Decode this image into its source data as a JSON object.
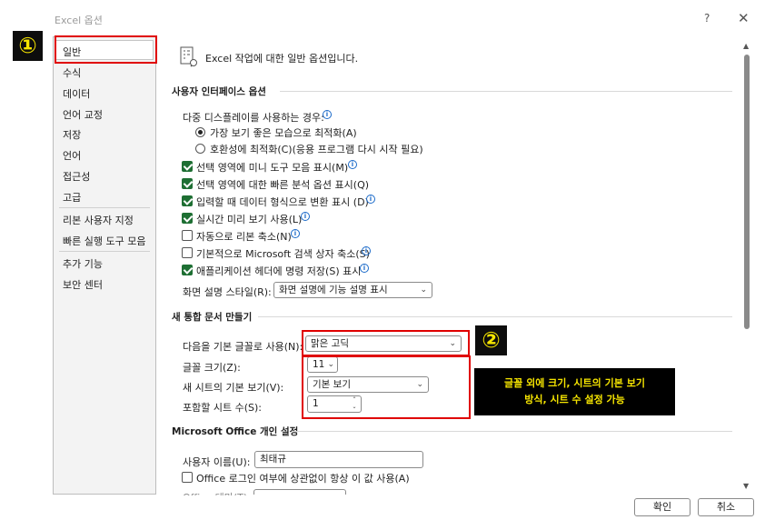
{
  "window": {
    "title": "Excel 옵션",
    "help": "?",
    "close": "✕"
  },
  "badges": {
    "one": "①",
    "two": "②"
  },
  "sidebar": {
    "items": [
      {
        "label": "일반"
      },
      {
        "label": "수식"
      },
      {
        "label": "데이터"
      },
      {
        "label": "언어 교정"
      },
      {
        "label": "저장"
      },
      {
        "label": "언어"
      },
      {
        "label": "접근성"
      },
      {
        "label": "고급"
      },
      {
        "label": "리본 사용자 지정"
      },
      {
        "label": "빠른 실행 도구 모음"
      },
      {
        "label": "추가 기능"
      },
      {
        "label": "보안 센터"
      }
    ]
  },
  "main": {
    "header": "Excel 작업에 대한 일반 옵션입니다.",
    "ui_section": {
      "title": "사용자 인터페이스 옵션",
      "multi_display_label": "다중 디스플레이를 사용하는 경우:",
      "radio_best": "가장 보기 좋은 모습으로 최적화(A)",
      "radio_compat": "호환성에 최적화(C)(응용 프로그램 다시 시작 필요)",
      "options": [
        {
          "label": "선택 영역에 미니 도구 모음 표시(M)",
          "checked": true
        },
        {
          "label": "선택 영역에 대한 빠른 분석 옵션 표시(Q)",
          "checked": true
        },
        {
          "label": "입력할 때 데이터 형식으로 변환 표시 (D)",
          "checked": true
        },
        {
          "label": "실시간 미리 보기 사용(L)",
          "checked": true
        },
        {
          "label": "자동으로 리본 축소(N)",
          "checked": false
        },
        {
          "label": "기본적으로 Microsoft 검색 상자 축소(S)",
          "checked": false
        },
        {
          "label": "애플리케이션 헤더에 명령 저장(S) 표시",
          "checked": true
        }
      ],
      "tooltip_label": "화면 설명 스타일(R):",
      "tooltip_value": "화면 설명에 기능 설명 표시"
    },
    "new_wb_section": {
      "title": "새 통합 문서 만들기",
      "font_label": "다음을 기본 글꼴로 사용(N):",
      "font_value": "맑은 고딕",
      "size_label": "글꼴 크기(Z):",
      "size_value": "11",
      "view_label": "새 시트의 기본 보기(V):",
      "view_value": "기본 보기",
      "sheets_label": "포함할 시트 수(S):",
      "sheets_value": "1"
    },
    "personal_section": {
      "title": "Microsoft Office 개인 설정",
      "username_label": "사용자 이름(U):",
      "username_value": "최태규",
      "always_use_label": "Office 로그인 여부에 상관없이 항상 이 값 사용(A)",
      "theme_label": "Office 테마(T):"
    }
  },
  "callout": {
    "line1": "글꼴 외에 크기, 시트의 기본 보기",
    "line2": "방식, 시트 수 설정 가능"
  },
  "buttons": {
    "ok": "확인",
    "cancel": "취소"
  },
  "colors": {
    "highlight_border": "#e00000",
    "badge_bg": "#0d0d0d",
    "badge_fg": "#f5e400",
    "checkbox_on": "#1e6f33",
    "info_icon": "#1b6ac9"
  }
}
